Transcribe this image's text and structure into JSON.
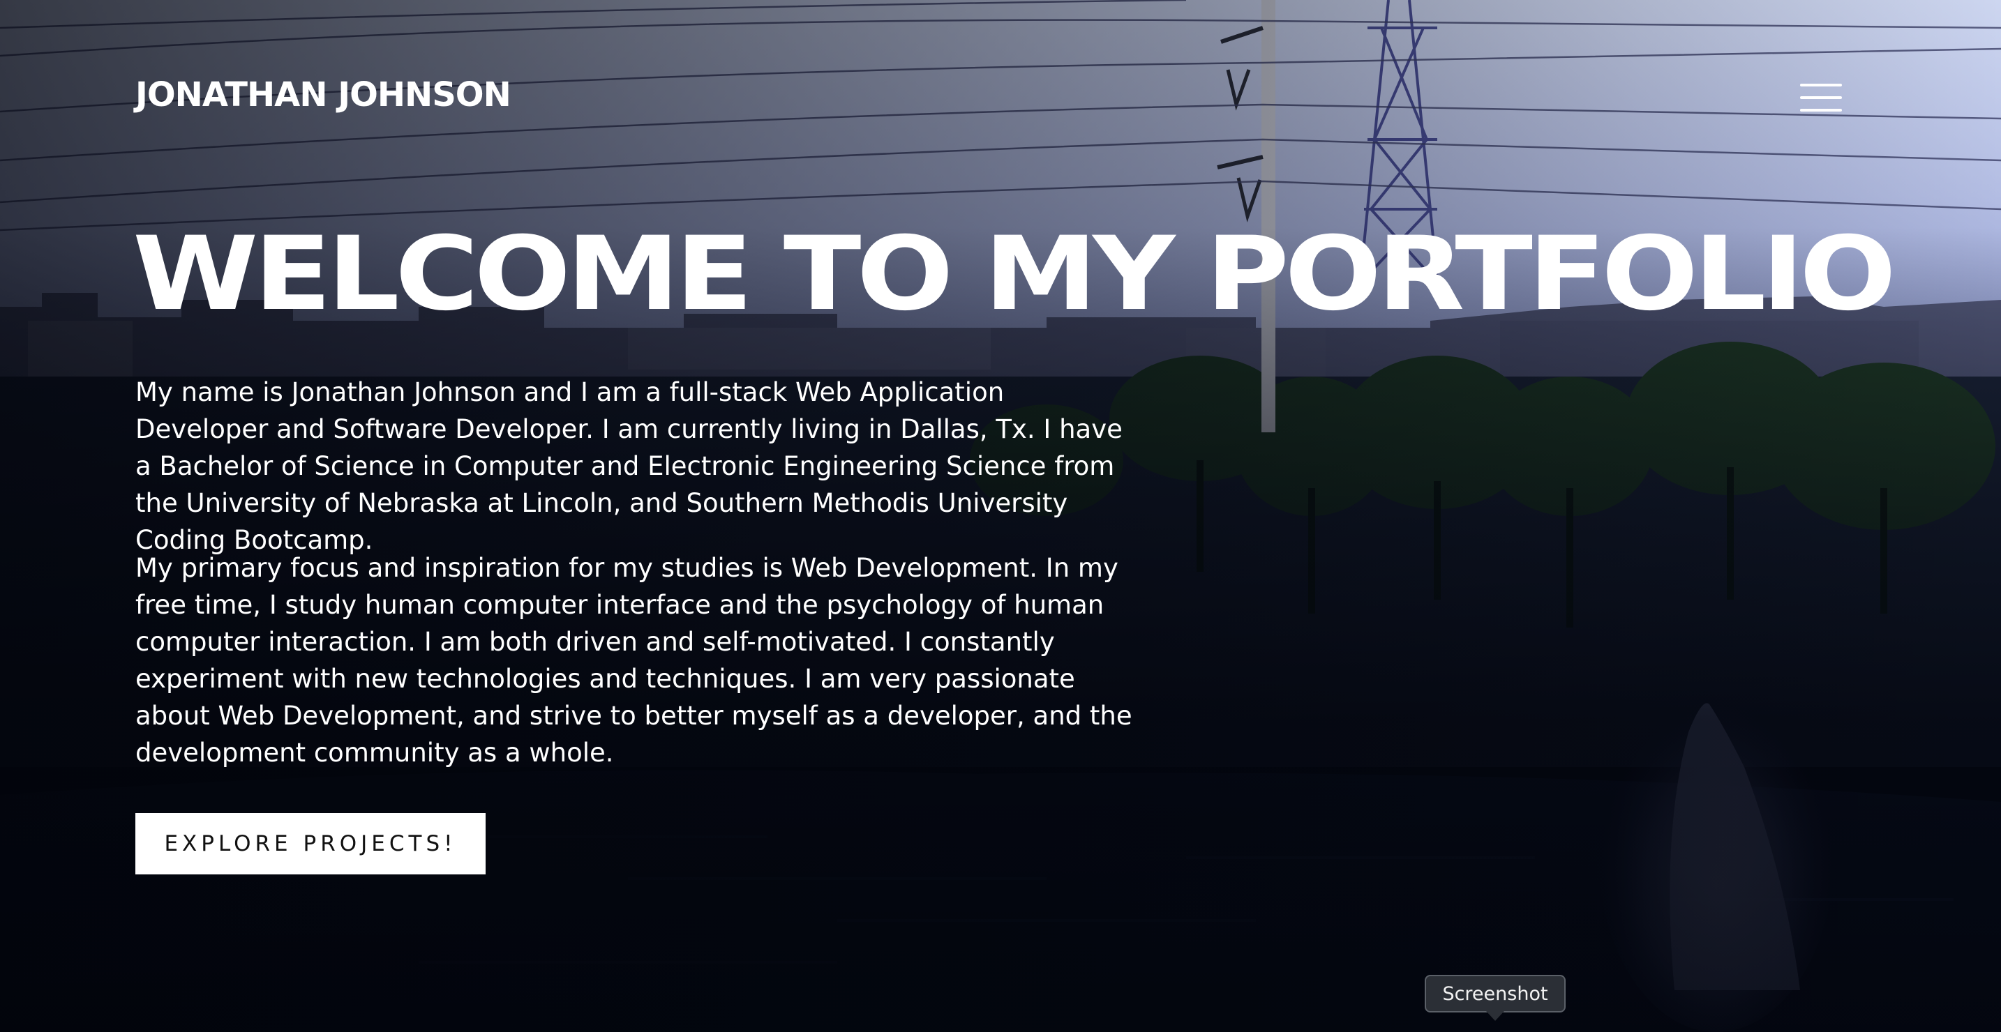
{
  "header": {
    "site_name": "JONATHAN JOHNSON",
    "menu_icon": "hamburger-menu-icon"
  },
  "hero": {
    "title": "WELCOME TO MY PORTFOLIO",
    "paragraphs": [
      "My name is Jonathan Johnson and I am a full-stack Web Application Developer and Software Developer. I am currently living in Dallas, Tx. I have a Bachelor of Science in Computer and Electronic Engineering Science from the University of Nebraska at Lincoln, and Southern Methodis University Coding Bootcamp.",
      "My primary focus and inspiration for my studies is Web Development. In my free time, I study human computer interface and the psychology of human computer interaction. I am both driven and self-motivated. I constantly experiment with new technologies and techniques. I am very passionate about Web Development, and strive to better myself as a developer, and the development community as a whole."
    ],
    "cta_label": "EXPLORE PROJECTS!",
    "background": "dusk-park-fountain-photo"
  },
  "tooltip": {
    "label": "Screenshot"
  },
  "colors": {
    "text": "#ffffff",
    "sky_top": "#c9d2ee",
    "sky_bottom": "#9aa6d4",
    "dark_overlay": "#03060f",
    "button_bg": "#ffffff",
    "button_text": "#111111",
    "tooltip_bg": "#2b2f36"
  }
}
